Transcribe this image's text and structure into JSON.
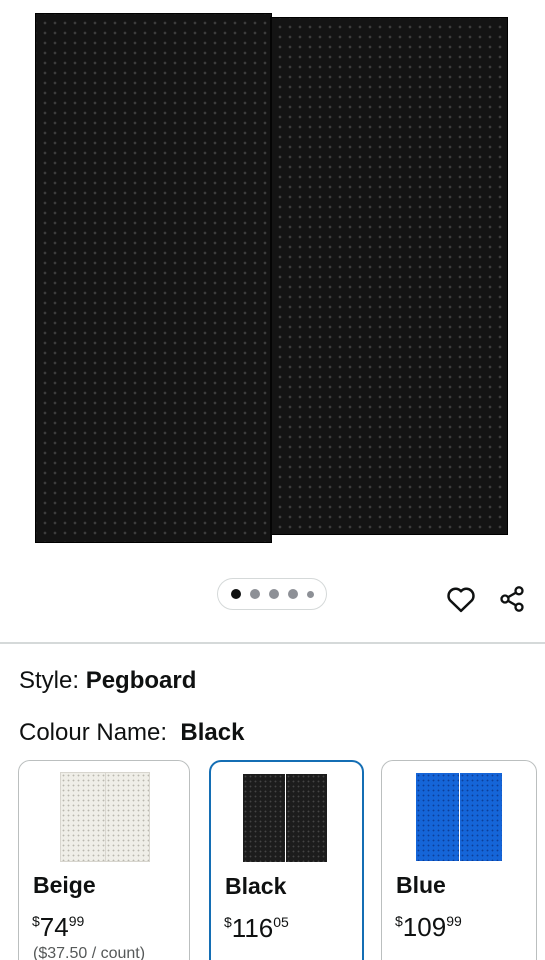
{
  "product": {
    "image_alt": "Black pegboard panels",
    "carousel": {
      "total": 5,
      "active": 1
    }
  },
  "actions": {
    "wishlist_icon": "heart-outline-icon",
    "share_icon": "share-icon"
  },
  "style": {
    "label": "Style:",
    "value": "Pegboard"
  },
  "colour": {
    "label": "Colour Name:",
    "value": "Black"
  },
  "swatches": [
    {
      "name": "Beige",
      "currency": "$",
      "whole": "74",
      "fraction": "99",
      "unit_price": "($37.50 / count)",
      "selected": false,
      "color": "#efeee8"
    },
    {
      "name": "Black",
      "currency": "$",
      "whole": "116",
      "fraction": "05",
      "unit_price": "",
      "selected": true,
      "color": "#1c1c1c"
    },
    {
      "name": "Blue",
      "currency": "$",
      "whole": "109",
      "fraction": "99",
      "unit_price": "",
      "selected": false,
      "color": "#1565d8"
    }
  ],
  "colors": {
    "selected_border": "#146eb4",
    "divider": "#d5d9d9"
  }
}
